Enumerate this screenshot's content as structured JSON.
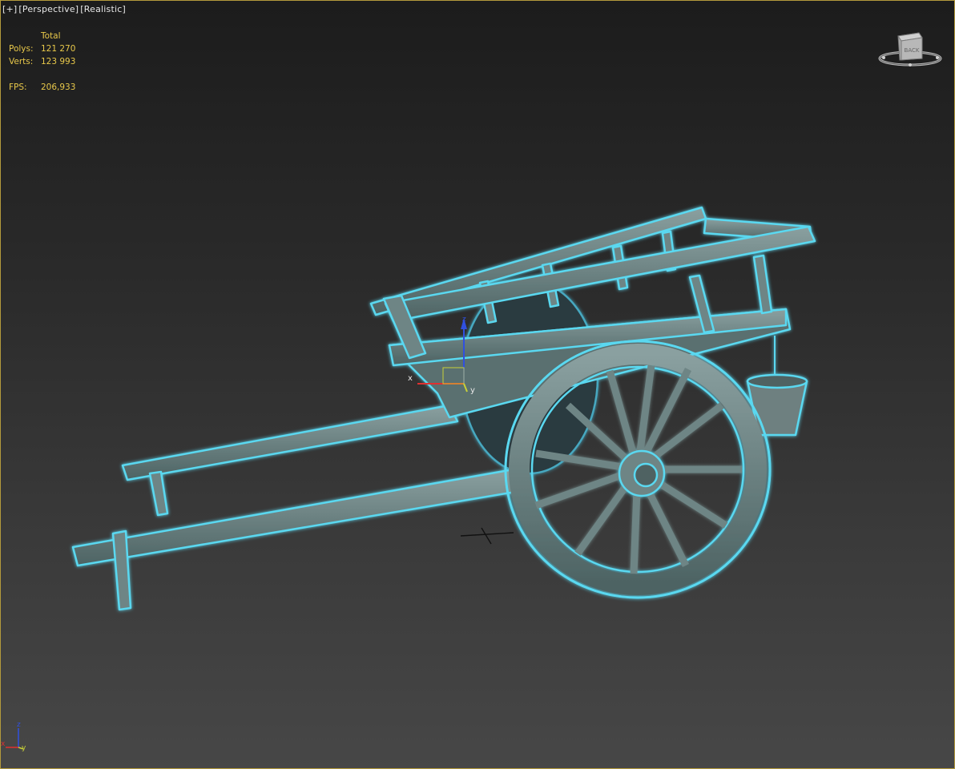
{
  "viewport": {
    "menu_plus": "[+]",
    "view_mode": "[Perspective]",
    "shading_mode": "[Realistic]"
  },
  "stats": {
    "header": "Total",
    "polys_label": "Polys:",
    "polys_value": "121 270",
    "verts_label": "Verts:",
    "verts_value": "123 993",
    "fps_label": "FPS:",
    "fps_value": "206,933"
  },
  "viewcube": {
    "face_label": "BACK"
  },
  "gizmo": {
    "x_label": "x",
    "y_label": "y",
    "z_label": "z"
  },
  "axis_tripod": {
    "x_label": "x",
    "y_label": "y",
    "z_label": "z"
  },
  "colors": {
    "selection_outline": "#5ad8f0",
    "wood": "#6e8585",
    "gizmo_x": "#e03030",
    "gizmo_y": "#c8d038",
    "gizmo_z": "#3050e0"
  }
}
